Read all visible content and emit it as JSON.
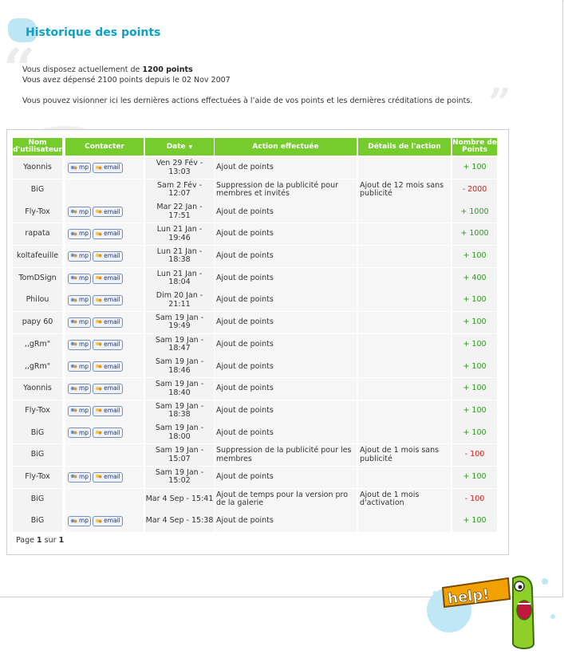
{
  "page": {
    "title": "Historique des points",
    "intro_line1_prefix": "Vous disposez actuellement de ",
    "intro_line1_bold": "1200 points",
    "intro_line2": "Vous avez dépensé 2100 points depuis le 02 Nov 2007",
    "intro_line3": "Vous pouvez visionner ici les dernières actions effectuées à l’aide de vos points et les dernières créditations de points."
  },
  "table": {
    "headers": {
      "user": "Nom d'utilisateur",
      "contact": "Contacter",
      "date": "Date",
      "action": "Action effectuée",
      "details": "Détails de l'action",
      "points": "Nombre de Points"
    },
    "mp_label": "mp",
    "email_label": "email",
    "rows": [
      {
        "user": "Yaonnis",
        "contact": true,
        "date": "Ven 29 Fév - 13:03",
        "action": "Ajout de points",
        "details": "",
        "points": "+ 100",
        "sign": "plus"
      },
      {
        "user": "BiG",
        "contact": false,
        "date": "Sam 2 Fév - 12:07",
        "action": "Suppression de la publicité pour membres et invités",
        "details": "Ajout de 12 mois sans publicité",
        "points": "- 2000",
        "sign": "minus"
      },
      {
        "user": "Fly-Tox",
        "contact": true,
        "date": "Mar 22 Jan - 17:51",
        "action": "Ajout de points",
        "details": "",
        "points": "+ 1000",
        "sign": "plus"
      },
      {
        "user": "rapata",
        "contact": true,
        "date": "Lun 21 Jan - 19:46",
        "action": "Ajout de points",
        "details": "",
        "points": "+ 1000",
        "sign": "plus"
      },
      {
        "user": "koltafeuille",
        "contact": true,
        "date": "Lun 21 Jan - 18:38",
        "action": "Ajout de points",
        "details": "",
        "points": "+ 100",
        "sign": "plus"
      },
      {
        "user": "TomDSign",
        "contact": true,
        "date": "Lun 21 Jan - 18:04",
        "action": "Ajout de points",
        "details": "",
        "points": "+ 400",
        "sign": "plus"
      },
      {
        "user": "Philou",
        "contact": true,
        "date": "Dim 20 Jan - 21:11",
        "action": "Ajout de points",
        "details": "",
        "points": "+ 100",
        "sign": "plus"
      },
      {
        "user": "papy 60",
        "contact": true,
        "date": "Sam 19 Jan - 19:49",
        "action": "Ajout de points",
        "details": "",
        "points": "+ 100",
        "sign": "plus"
      },
      {
        "user": ",,gRm\"",
        "contact": true,
        "date": "Sam 19 Jan - 18:47",
        "action": "Ajout de points",
        "details": "",
        "points": "+ 100",
        "sign": "plus"
      },
      {
        "user": ",,gRm\"",
        "contact": true,
        "date": "Sam 19 Jan - 18:46",
        "action": "Ajout de points",
        "details": "",
        "points": "+ 100",
        "sign": "plus"
      },
      {
        "user": "Yaonnis",
        "contact": true,
        "date": "Sam 19 Jan - 18:40",
        "action": "Ajout de points",
        "details": "",
        "points": "+ 100",
        "sign": "plus"
      },
      {
        "user": "Fly-Tox",
        "contact": true,
        "date": "Sam 19 Jan - 18:38",
        "action": "Ajout de points",
        "details": "",
        "points": "+ 100",
        "sign": "plus"
      },
      {
        "user": "BiG",
        "contact": true,
        "date": "Sam 19 Jan - 18:00",
        "action": "Ajout de points",
        "details": "",
        "points": "+ 100",
        "sign": "plus"
      },
      {
        "user": "BiG",
        "contact": false,
        "date": "Sam 19 Jan - 15:07",
        "action": "Suppression de la publicité pour les membres",
        "details": "Ajout de 1 mois sans publicité",
        "points": "- 100",
        "sign": "minus"
      },
      {
        "user": "Fly-Tox",
        "contact": true,
        "date": "Sam 19 Jan - 15:02",
        "action": "Ajout de points",
        "details": "",
        "points": "+ 100",
        "sign": "plus"
      },
      {
        "user": "BiG",
        "contact": false,
        "date": "Mar 4 Sep - 15:41",
        "action": "Ajout de temps pour la version pro de la galerie",
        "details": "Ajout de 1 mois d'activation",
        "points": "- 100",
        "sign": "minus"
      },
      {
        "user": "BiG",
        "contact": true,
        "date": "Mar 4 Sep - 15:38",
        "action": "Ajout de points",
        "details": "",
        "points": "+ 100",
        "sign": "plus"
      }
    ]
  },
  "pagination": {
    "prefix": "Page ",
    "current": "1",
    "sep": " sur ",
    "total": "1"
  },
  "colors": {
    "accent": "#0ba1c9",
    "header_green": "#76cc2c",
    "plus": "#2e9a1f",
    "minus": "#d01b1b"
  },
  "help_badge": {
    "text": "help!"
  }
}
